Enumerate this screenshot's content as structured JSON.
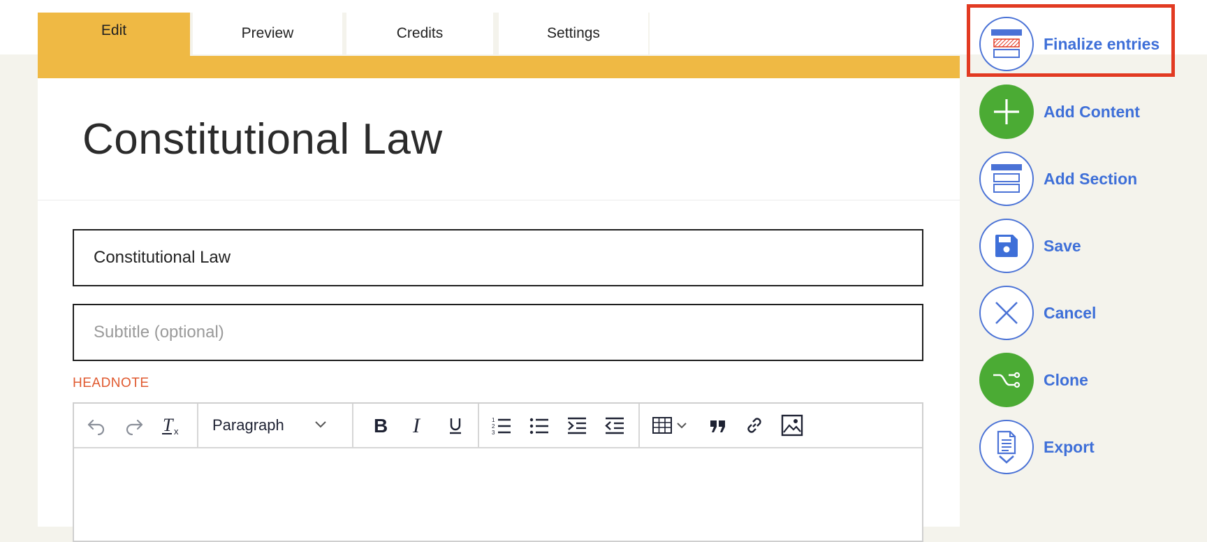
{
  "tabs": [
    {
      "label": "Edit",
      "active": true
    },
    {
      "label": "Preview",
      "active": false
    },
    {
      "label": "Credits",
      "active": false
    },
    {
      "label": "Settings",
      "active": false
    }
  ],
  "page": {
    "title": "Constitutional Law",
    "title_field_value": "Constitutional Law",
    "subtitle_placeholder": "Subtitle (optional)",
    "headnote_label": "HEADNOTE"
  },
  "editor_toolbar": {
    "format_select_value": "Paragraph",
    "buttons": [
      "undo-icon",
      "redo-icon",
      "clear-formatting-icon",
      "bold-icon",
      "italic-icon",
      "underline-icon",
      "numbered-list-icon",
      "bulleted-list-icon",
      "indent-icon",
      "outdent-icon",
      "table-icon",
      "blockquote-icon",
      "link-icon",
      "image-icon"
    ]
  },
  "actions": [
    {
      "label": "Finalize entries",
      "icon": "finalize-icon",
      "highlighted": true
    },
    {
      "label": "Add Content",
      "icon": "plus-icon"
    },
    {
      "label": "Add Section",
      "icon": "section-icon"
    },
    {
      "label": "Save",
      "icon": "floppy-disk-icon"
    },
    {
      "label": "Cancel",
      "icon": "close-icon"
    },
    {
      "label": "Clone",
      "icon": "branch-icon"
    },
    {
      "label": "Export",
      "icon": "document-export-icon"
    }
  ],
  "colors": {
    "accent_gold": "#efb944",
    "action_blue": "#3e6fd8",
    "green": "#4bab34",
    "headnote_orange": "#e05a30",
    "highlight_red": "#e23a22",
    "page_bg": "#f4f3ec"
  }
}
